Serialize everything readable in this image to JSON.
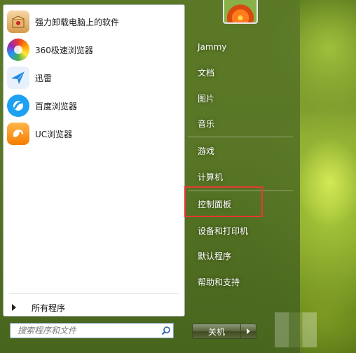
{
  "programs": [
    {
      "label": "强力卸载电脑上的软件",
      "icon": "uninstall-box-icon"
    },
    {
      "label": "360极速浏览器",
      "icon": "360-browser-icon"
    },
    {
      "label": "迅雷",
      "icon": "xunlei-bird-icon"
    },
    {
      "label": "百度浏览器",
      "icon": "baidu-browser-icon"
    },
    {
      "label": "UC浏览器",
      "icon": "uc-browser-icon"
    }
  ],
  "all_programs": {
    "label": "所有程序"
  },
  "search": {
    "placeholder": "搜索程序和文件"
  },
  "right_menu": [
    {
      "label": "Jammy"
    },
    {
      "label": "文档"
    },
    {
      "label": "图片"
    },
    {
      "label": "音乐"
    },
    {
      "label": "游戏"
    },
    {
      "label": "计算机"
    },
    {
      "label": "控制面板"
    },
    {
      "label": "设备和打印机"
    },
    {
      "label": "默认程序"
    },
    {
      "label": "帮助和支持"
    }
  ],
  "shutdown": {
    "label": "关机"
  },
  "colors": {
    "highlight": "#e53935",
    "panel": "#ffffff"
  }
}
